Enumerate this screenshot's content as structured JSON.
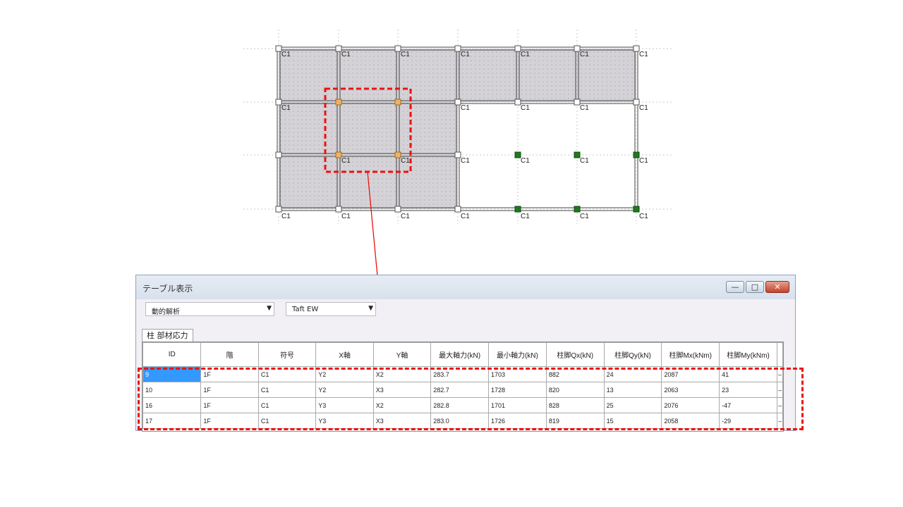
{
  "plan": {
    "column_label": "C1"
  },
  "window": {
    "title": "テーブル表示",
    "buttons": [
      "—",
      "□",
      "✕"
    ]
  },
  "analysis_select": {
    "value": "動的解析"
  },
  "wave_select": {
    "value": "Taft EW"
  },
  "tab": {
    "label": "柱 部材応力"
  },
  "table": {
    "columns": [
      "ID",
      "階",
      "符号",
      "X軸",
      "Y軸",
      "最大軸力(kN)",
      "最小軸力(kN)",
      "柱脚Qx(kN)",
      "柱脚Qy(kN)",
      "柱脚Mx(kNm)",
      "柱脚My(kNm)"
    ],
    "rows": [
      [
        "9",
        "1F",
        "C1",
        "Y2",
        "X2",
        "283.7",
        "1703",
        "882",
        "24",
        "2087",
        "41"
      ],
      [
        "10",
        "1F",
        "C1",
        "Y2",
        "X3",
        "282.7",
        "1728",
        "820",
        "13",
        "2063",
        "23"
      ],
      [
        "16",
        "1F",
        "C1",
        "Y3",
        "X2",
        "282.8",
        "1701",
        "828",
        "25",
        "2076",
        "-47"
      ],
      [
        "17",
        "1F",
        "C1",
        "Y3",
        "X3",
        "283.0",
        "1726",
        "819",
        "15",
        "2058",
        "-29"
      ]
    ]
  },
  "colors": {
    "highlight": "#ee1111",
    "selected_column_node": "#f0b366",
    "node_green": "#1f7a1f",
    "slab": "#d4d2d6"
  }
}
